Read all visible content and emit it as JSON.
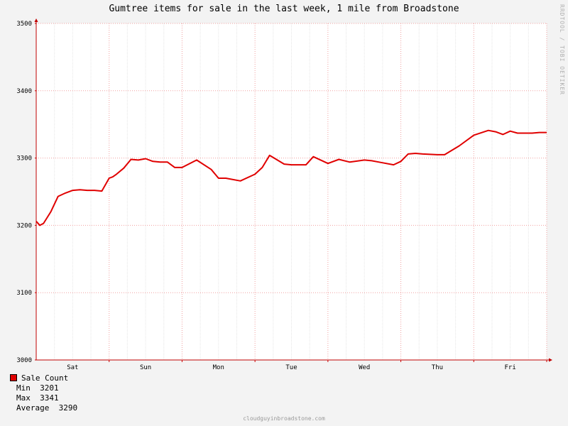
{
  "chart_data": {
    "type": "line",
    "title": "Gumtree items for sale in the last week, 1 mile from Broadstone",
    "xlabel": "",
    "ylabel": "",
    "ylim": [
      3000,
      3500
    ],
    "xlim": [
      0,
      7
    ],
    "y_ticks": [
      3000,
      3100,
      3200,
      3300,
      3400,
      3500
    ],
    "x_tick_labels": [
      {
        "label": "Sat",
        "x": 0.5
      },
      {
        "label": "Sun",
        "x": 1.5
      },
      {
        "label": "Mon",
        "x": 2.5
      },
      {
        "label": "Tue",
        "x": 3.5
      },
      {
        "label": "Wed",
        "x": 4.5
      },
      {
        "label": "Thu",
        "x": 5.5
      },
      {
        "label": "Fri",
        "x": 6.5
      }
    ],
    "grid": true,
    "legend_position": "bottom-left",
    "series": [
      {
        "name": "Sale Count",
        "color": "#e00000",
        "x": [
          0,
          0.05,
          0.1,
          0.2,
          0.3,
          0.4,
          0.5,
          0.6,
          0.7,
          0.8,
          0.9,
          1.0,
          1.05,
          1.1,
          1.2,
          1.3,
          1.4,
          1.5,
          1.6,
          1.7,
          1.8,
          1.9,
          2.0,
          2.2,
          2.4,
          2.5,
          2.6,
          2.8,
          3.0,
          3.1,
          3.2,
          3.4,
          3.5,
          3.7,
          3.8,
          4.0,
          4.15,
          4.3,
          4.5,
          4.6,
          4.7,
          4.9,
          5.0,
          5.1,
          5.2,
          5.3,
          5.5,
          5.6,
          5.8,
          6.0,
          6.2,
          6.3,
          6.4,
          6.5,
          6.6,
          6.7,
          6.8,
          6.9,
          7.0
        ],
        "values": [
          3206,
          3200,
          3203,
          3220,
          3243,
          3248,
          3252,
          3253,
          3252,
          3252,
          3251,
          3270,
          3272,
          3276,
          3285,
          3298,
          3297,
          3299,
          3295,
          3294,
          3294,
          3286,
          3286,
          3297,
          3283,
          3270,
          3270,
          3266,
          3276,
          3286,
          3304,
          3291,
          3290,
          3290,
          3302,
          3292,
          3298,
          3294,
          3297,
          3296,
          3294,
          3290,
          3295,
          3306,
          3307,
          3306,
          3305,
          3305,
          3318,
          3334,
          3341,
          3339,
          3335,
          3340,
          3337,
          3337,
          3337,
          3338,
          3338
        ]
      }
    ]
  },
  "legend": {
    "series_label": "Sale Count",
    "min_label": "Min",
    "min_value": "3201",
    "max_label": "Max",
    "max_value": "3341",
    "avg_label": "Average",
    "avg_value": "3290"
  },
  "watermark": "RRDTOOL / TOBI OETIKER",
  "footer": "cloudguyinbroadstone.com"
}
